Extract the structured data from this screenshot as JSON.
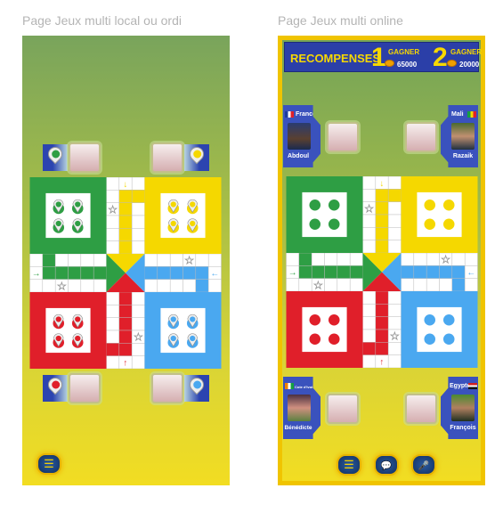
{
  "left_panel": {
    "title": "Page Jeux multi local ou ordi",
    "menu_icon": "list-icon"
  },
  "right_panel": {
    "title": "Page Jeux multi online",
    "rewards": {
      "label": "RECOMPENSES",
      "first": {
        "rank": "1",
        "label": "GAGNER",
        "amount": "65000"
      },
      "second": {
        "rank": "2",
        "label": "GAGNER",
        "amount": "20000"
      }
    },
    "players": [
      {
        "name": "Abdoul",
        "country": "France"
      },
      {
        "name": "Razaik",
        "country": "Mali"
      },
      {
        "name": "Bénédicte",
        "country": "Cote d'Ivoire"
      },
      {
        "name": "François",
        "country": "Egypte"
      }
    ],
    "buttons": [
      "list-icon",
      "chat-icon",
      "microphone-icon"
    ]
  },
  "colors": {
    "green": "#2e9e44",
    "yellow": "#f5d800",
    "red": "#e01f2a",
    "blue": "#4aa8f0",
    "panel_border": "#f0c400",
    "banner": "#2b3fa8"
  },
  "arrows": {
    "green": "→",
    "yellow": "↓",
    "blue": "←",
    "red": "↑"
  }
}
